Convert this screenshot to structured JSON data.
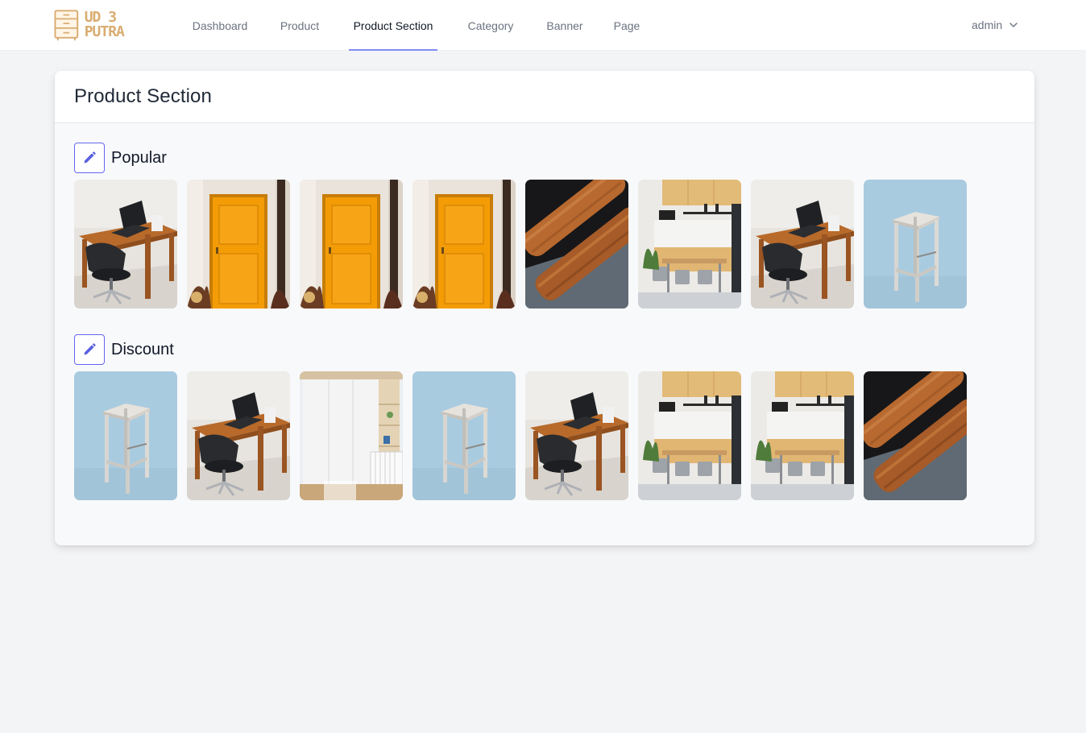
{
  "brand": {
    "logo_text": "UD 3 PUTRA",
    "logo_color": "#d9ac70"
  },
  "nav": {
    "items": [
      {
        "label": "Dashboard"
      },
      {
        "label": "Product"
      },
      {
        "label": "Product Section",
        "active": true
      },
      {
        "label": "Category"
      },
      {
        "label": "Banner"
      },
      {
        "label": "Page"
      }
    ],
    "active_color": "#818cf8"
  },
  "user": {
    "name": "admin",
    "dropdown_icon": "chevron-down-icon"
  },
  "page": {
    "title": "Product Section"
  },
  "sections": [
    {
      "title": "Popular",
      "edit_icon": "pencil-icon",
      "items": [
        "desk-chair",
        "orange-door",
        "orange-door",
        "orange-door",
        "wood-plank",
        "kitchen-dining",
        "desk-chair",
        "bar-stool"
      ]
    },
    {
      "title": "Discount",
      "edit_icon": "pencil-icon",
      "items": [
        "bar-stool",
        "desk-chair",
        "wardrobe",
        "bar-stool",
        "desk-chair",
        "kitchen-dining",
        "kitchen-dining",
        "wood-plank"
      ]
    }
  ],
  "colors": {
    "accent": "#6366f1",
    "page_bg": "#f3f4f6",
    "card_bg": "#f8f9fb"
  }
}
